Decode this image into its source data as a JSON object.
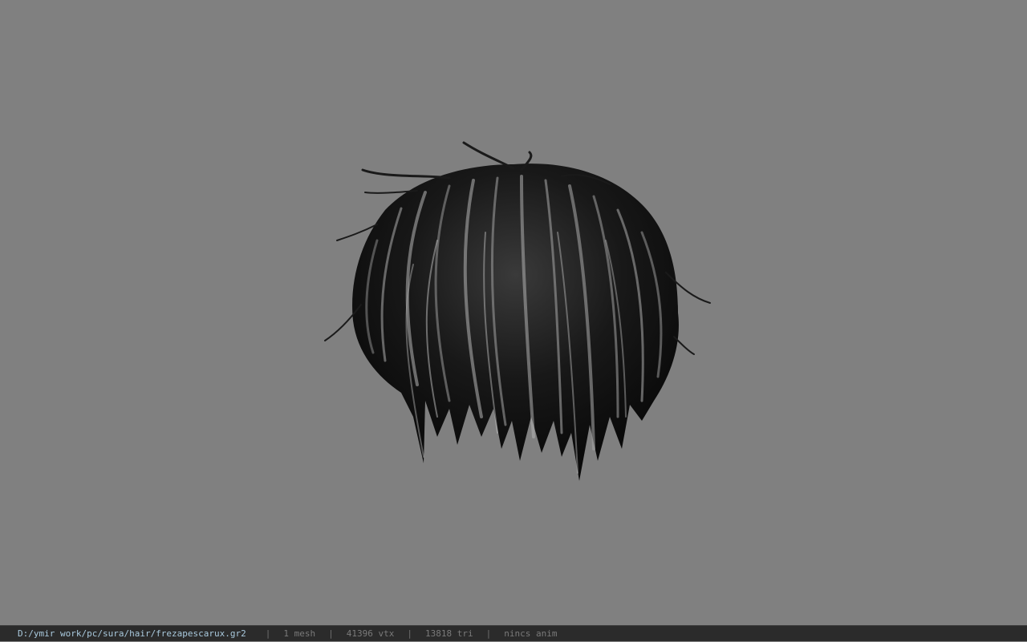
{
  "viewport": {
    "background": "#808080",
    "model_name": "hair-mesh"
  },
  "status": {
    "file_path": "D:/ymir work/pc/sura/hair/frezapescarux.gr2",
    "separator": "|",
    "mesh": "1 mesh",
    "vertices": "41396 vtx",
    "triangles": "13818 tri",
    "anim": "nincs anim"
  }
}
